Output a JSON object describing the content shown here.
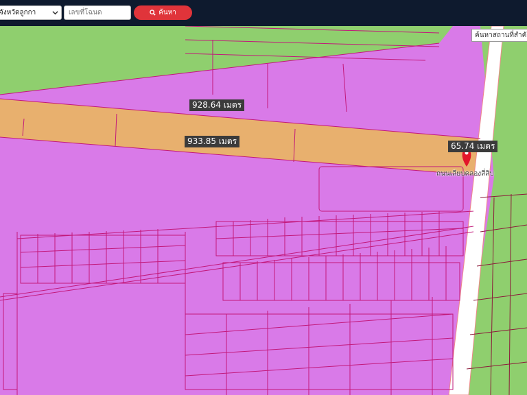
{
  "toolbar": {
    "province_select": "จังหวัดลูกกา",
    "deed_placeholder": "เลขที่โฉนด",
    "search_label": "ค้นหา"
  },
  "map": {
    "measurements": [
      "928.64 เมตร",
      "933.85 เมตร",
      "65.74 เมตร"
    ],
    "landmark_search": "ค้นหาสถานที่สำคัญ",
    "place_label": "ถนนเลียบคลองสี่สิบ"
  },
  "colors": {
    "topbar": "#0e1a2e",
    "zone_pink": "#d97ae8",
    "zone_green": "#8fcf6e",
    "zone_orange": "#e8b06e",
    "parcel_lines": "#c2187a",
    "search_button": "#e0343a",
    "marker": "#e2162a"
  }
}
